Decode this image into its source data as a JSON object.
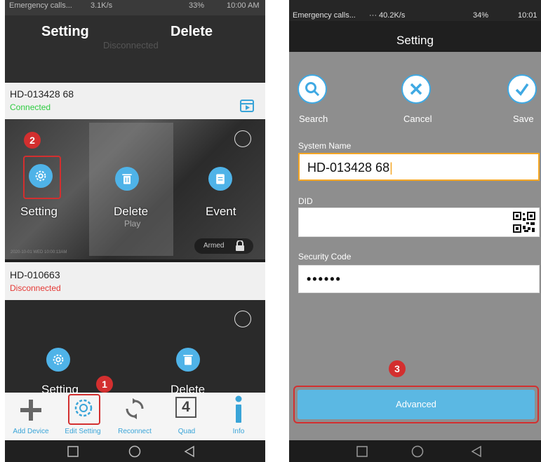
{
  "left_screen": {
    "statusbar": {
      "carrier": "Emergency calls...",
      "speed": "3.1K/s",
      "battery": "33%",
      "time": "10:00 AM"
    },
    "top_card": {
      "setting_label": "Setting",
      "delete_label": "Delete",
      "status_faint": "Disconnected"
    },
    "device1": {
      "name": "HD-013428 68",
      "status": "Connected",
      "setting_label": "Setting",
      "delete_label": "Delete",
      "event_label": "Event",
      "play_label": "Play",
      "armed_label": "Armed",
      "timestamp": "2020-10-01 WED 10:00:13AM"
    },
    "device2": {
      "name": "HD-010663",
      "status": "Disconnected",
      "setting_label": "Setting",
      "delete_label": "Delete"
    },
    "toolbar": {
      "add_device": "Add Device",
      "edit_setting": "Edit Setting",
      "reconnect": "Reconnect",
      "quad": "Quad",
      "quad_number": "4",
      "info": "Info"
    },
    "badges": {
      "step1": "1",
      "step2": "2"
    }
  },
  "right_screen": {
    "statusbar": {
      "carrier": "Emergency calls...",
      "speed": "··· 40.2K/s",
      "battery": "34%",
      "time": "10:01"
    },
    "title": "Setting",
    "actions": {
      "search": "Search",
      "cancel": "Cancel",
      "save": "Save"
    },
    "form": {
      "system_name_label": "System Name",
      "system_name_value": "HD-013428 68",
      "did_label": "DID",
      "did_value": "",
      "security_code_label": "Security Code",
      "security_code_value": "••••••"
    },
    "advanced_button": "Advanced",
    "badges": {
      "step3": "3"
    }
  },
  "colors": {
    "accent_blue": "#4fb3e8",
    "connected_green": "#2ecc40",
    "disconnected_red": "#e53935",
    "badge_red": "#d32f2f",
    "highlight_orange": "#f5a623",
    "advanced_blue": "#5bb8e3"
  }
}
